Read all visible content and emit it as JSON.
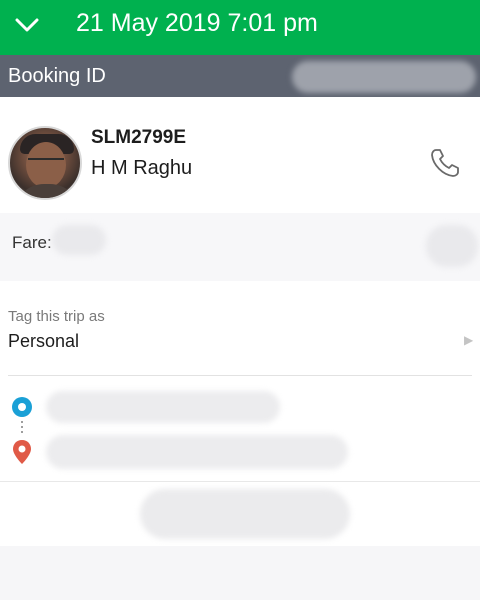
{
  "header": {
    "back_icon": "chevron-down-icon",
    "datetime": "21 May 2019 7:01 pm",
    "color": "#00b14f"
  },
  "booking": {
    "label": "Booking ID",
    "color": "#5d6370"
  },
  "driver": {
    "plate": "SLM2799E",
    "name": "H M Raghu",
    "call_icon": "phone-icon"
  },
  "fare": {
    "label": "Fare:"
  },
  "tag": {
    "label": "Tag this trip as",
    "value": "Personal",
    "chevron_icon": "chevron-right-icon"
  },
  "route": {
    "pickup_icon": "pickup-dot-icon",
    "pickup_color": "#1aa0d6",
    "dropoff_icon": "dropoff-pin-icon",
    "dropoff_color": "#e05a47"
  }
}
